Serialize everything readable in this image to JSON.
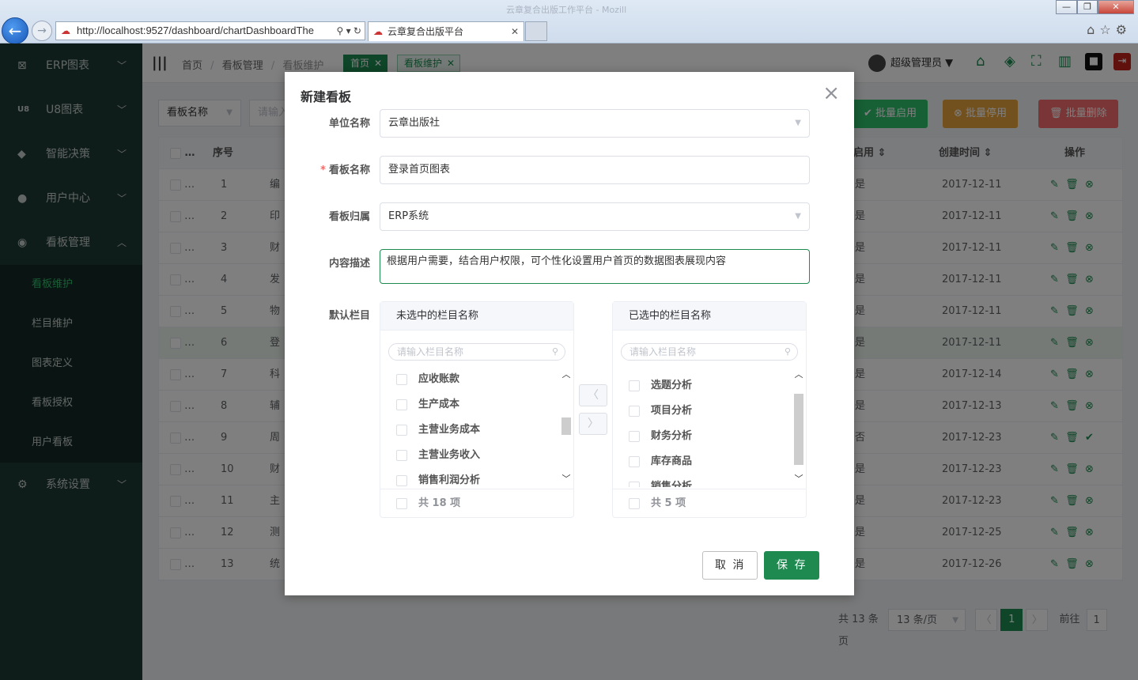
{
  "browser": {
    "window_title": "云章复合出版工作平台 - Mozill",
    "url": "http://localhost:9527/dashboard/chartDashboardThe",
    "tab_title": "云章复合出版平台",
    "win_buttons": [
      "—",
      "❐",
      "✕"
    ]
  },
  "sidebar": {
    "menus": [
      {
        "label": "ERP图表",
        "icon": "chart-icon",
        "glyph": "⊠",
        "chev": "﹀"
      },
      {
        "label": "U8图表",
        "icon": "u8-icon",
        "glyph": "U8",
        "chev": "﹀"
      },
      {
        "label": "智能决策",
        "icon": "bulb-icon",
        "glyph": "◆",
        "chev": "﹀"
      },
      {
        "label": "用户中心",
        "icon": "user-icon",
        "glyph": "●",
        "chev": "﹀"
      },
      {
        "label": "看板管理",
        "icon": "dashboard-icon",
        "glyph": "◉",
        "chev": "︿"
      }
    ],
    "submenu": [
      "看板维护",
      "栏目维护",
      "图表定义",
      "看板授权",
      "用户看板"
    ],
    "settings": {
      "label": "系统设置",
      "glyph": "⚙",
      "chev": "﹀"
    }
  },
  "header": {
    "breadcrumb": [
      "首页",
      "/",
      "看板管理",
      "/",
      "看板维护"
    ],
    "tags": [
      {
        "label": "首页"
      },
      {
        "label": "看板维护"
      }
    ],
    "user": "超级管理员 ▼"
  },
  "filters": {
    "select_label": "看板名称",
    "input_placeholder": "请输入"
  },
  "actions": {
    "enable": "✔ 批量启用",
    "disable": "⊗ 批量停用",
    "delete": "🗑 批量删除"
  },
  "table": {
    "headers": {
      "check": "…",
      "index": "序号",
      "enabled": "启用 ⇕",
      "created": "创建时间 ⇕",
      "ops": "操作"
    },
    "rows": [
      {
        "n": "1",
        "name": "编",
        "en": "是",
        "date": "2017-12-11"
      },
      {
        "n": "2",
        "name": "印",
        "en": "是",
        "date": "2017-12-11"
      },
      {
        "n": "3",
        "name": "财",
        "en": "是",
        "date": "2017-12-11"
      },
      {
        "n": "4",
        "name": "发",
        "en": "是",
        "date": "2017-12-11"
      },
      {
        "n": "5",
        "name": "物",
        "en": "是",
        "date": "2017-12-11"
      },
      {
        "n": "6",
        "name": "登",
        "en": "是",
        "date": "2017-12-11"
      },
      {
        "n": "7",
        "name": "科",
        "en": "是",
        "date": "2017-12-14"
      },
      {
        "n": "8",
        "name": "辅",
        "en": "是",
        "date": "2017-12-13"
      },
      {
        "n": "9",
        "name": "周",
        "en": "否",
        "date": "2017-12-23"
      },
      {
        "n": "10",
        "name": "财",
        "en": "是",
        "date": "2017-12-23"
      },
      {
        "n": "11",
        "name": "主",
        "en": "是",
        "date": "2017-12-23"
      },
      {
        "n": "12",
        "name": "测",
        "en": "是",
        "date": "2017-12-25"
      },
      {
        "n": "13",
        "name": "统",
        "en": "是",
        "date": "2017-12-26"
      }
    ]
  },
  "pager": {
    "total": "共 13 条",
    "size": "13 条/页",
    "prev": "〈",
    "page": "1",
    "next": "〉",
    "goto": "前往",
    "goto_value": "1",
    "suffix": "页"
  },
  "dialog": {
    "title": "新建看板",
    "close": "×",
    "fields": {
      "unit_label": "单位名称",
      "unit_value": "云章出版社",
      "name_label": "看板名称",
      "name_value": "登录首页图表",
      "owner_label": "看板归属",
      "owner_value": "ERP系统",
      "desc_label": "内容描述",
      "desc_value": "根据用户需要，结合用户权限，可个性化设置用户首页的数据图表展现内容",
      "columns_label": "默认栏目",
      "required_mark": "*"
    },
    "transfer": {
      "left_title": "未选中的栏目名称",
      "right_title": "已选中的栏目名称",
      "search_placeholder": "请输入栏目名称",
      "left_items": [
        "应收账款",
        "生产成本",
        "主营业务成本",
        "主营业务收入",
        "销售利润分析"
      ],
      "right_items": [
        "选题分析",
        "项目分析",
        "财务分析",
        "库存商品",
        "销售分析"
      ],
      "left_total": "共 18 项",
      "right_total": "共 5 项",
      "to_left": "〈",
      "to_right": "〉"
    },
    "cancel": "取 消",
    "save": "保 存"
  },
  "colors": {
    "primary": "#1e8a50",
    "sidebar": "#1f3a35",
    "warning": "#e6a23c",
    "danger": "#f56c6c"
  }
}
